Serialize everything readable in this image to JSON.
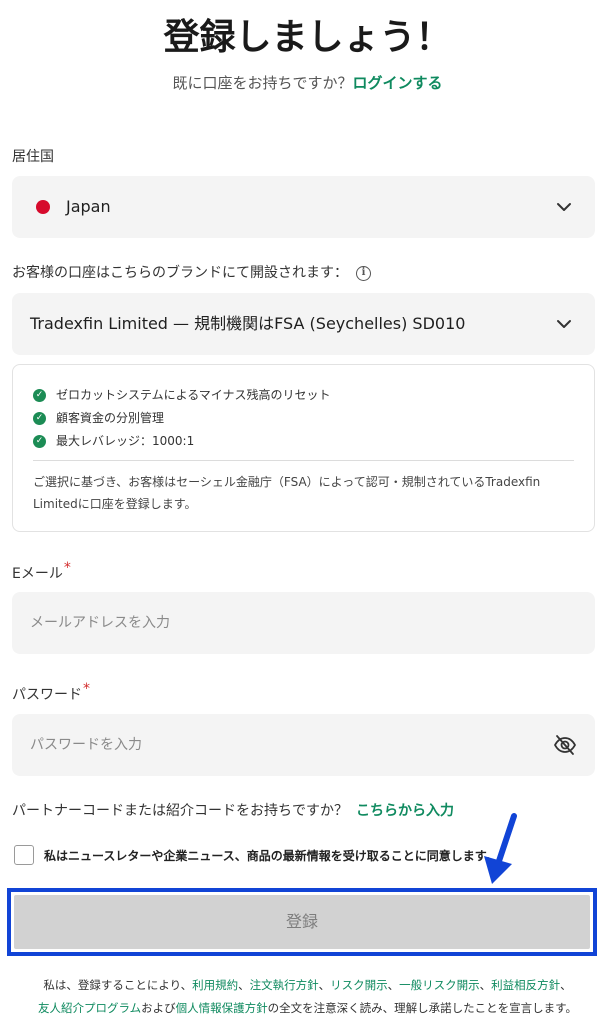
{
  "header": {
    "title": "登録しましょう！",
    "login_prompt": "既に口座をお持ちですか？",
    "login_link": "ログインする"
  },
  "country": {
    "label": "居住国",
    "selected": "Japan",
    "flag_color": "#d60a2c"
  },
  "brand": {
    "label": "お客様の口座はこちらのブランドにて開設されます：",
    "selected": "Tradexfin Limited — 規制機関はFSA (Seychelles) SD010"
  },
  "features": {
    "items": [
      "ゼロカットシステムによるマイナス残高のリセット",
      "顧客資金の分別管理",
      "最大レバレッジ：1000:1"
    ],
    "note": "ご選択に基づき、お客様はセーシェル金融庁（FSA）によって認可・規制されているTradexfin Limitedに口座を登録します。"
  },
  "email": {
    "label": "Eメール",
    "required_mark": "*",
    "placeholder": "メールアドレスを入力"
  },
  "password": {
    "label": "パスワード",
    "required_mark": "*",
    "placeholder": "パスワードを入力"
  },
  "partner": {
    "prompt": "パートナーコードまたは紹介コードをお持ちですか？",
    "link": "こちらから入力"
  },
  "newsletter": {
    "label": "私はニュースレターや企業ニュース、商品の最新情報を受け取ることに同意します。",
    "checked": false
  },
  "submit": {
    "label": "登録"
  },
  "terms": {
    "prefix": "私は、登録することにより、",
    "links": [
      "利用規約",
      "注文執行方針",
      "リスク開示",
      "一般リスク開示",
      "利益相反方針",
      "友人紹介プログラム",
      "個人情報保護方針"
    ],
    "sep": "、",
    "and": "および",
    "suffix": "の全文を注意深く読み、理解し承諾したことを宣言します。"
  },
  "colors": {
    "accent": "#0f8a5f",
    "annotation_blue": "#1144d6",
    "required": "#d22b2b"
  }
}
